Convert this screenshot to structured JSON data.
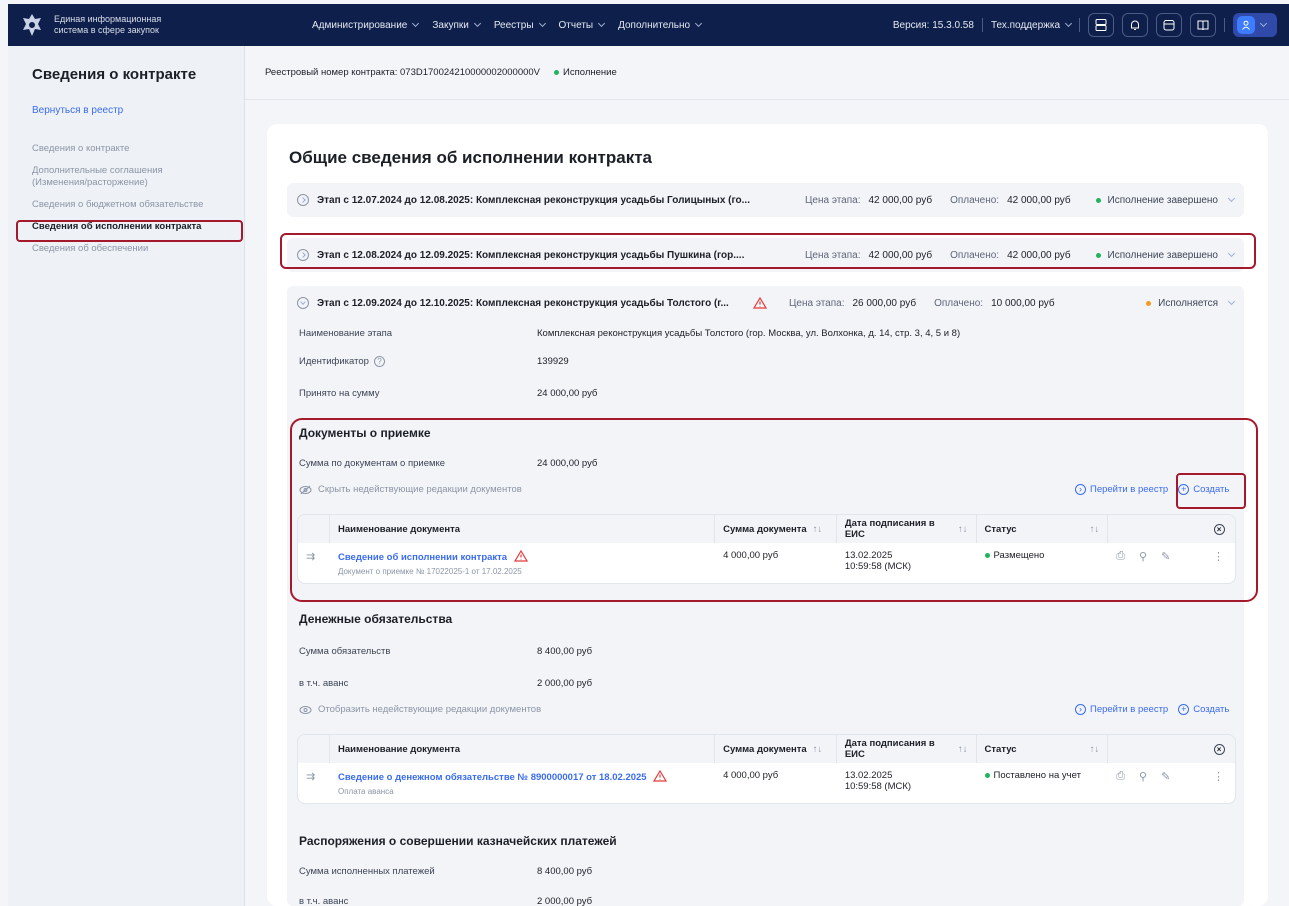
{
  "header": {
    "logo_text_line1": "Единая информационная",
    "logo_text_line2": "система в сфере закупок",
    "nav": [
      "Администрирование",
      "Закупки",
      "Реестры",
      "Отчеты",
      "Дополнительно"
    ],
    "version": "Версия: 15.3.0.58",
    "support": "Тех.поддержка",
    "colors": {
      "header_bg": "#0f1f4b",
      "accent": "#3a6cf0",
      "highlight": "#a5192c"
    }
  },
  "sidebar": {
    "title": "Сведения о контракте",
    "back": "Вернуться в реестр",
    "items": [
      "Сведения о контракте",
      "Дополнительные соглашения",
      "(Изменения/расторжение)",
      "Сведения о бюджетном обязательстве",
      "Сведения об исполнении контракта",
      "Сведения об обеспечении"
    ]
  },
  "topstrip": {
    "reg_number": "Реестровый номер контракта: 073D170024210000002000000V",
    "status": "Исполнение"
  },
  "main": {
    "title": "Общие сведения об исполнении контракта",
    "stages": [
      {
        "name": "Этап с 12.07.2024 до 12.08.2025: Комплексная реконструкция усадьбы Голицыных (го...",
        "price_label": "Цена этапа:",
        "price": "42 000,00 руб",
        "paid_label": "Оплачено:",
        "paid": "42 000,00 руб",
        "status": "Исполнение завершено"
      },
      {
        "name": "Этап с 12.08.2024 до 12.09.2025: Комплексная реконструкция усадьбы Пушкина (гор....",
        "price_label": "Цена этапа:",
        "price": "42 000,00 руб",
        "paid_label": "Оплачено:",
        "paid": "42 000,00 руб",
        "status": "Исполнение завершено"
      },
      {
        "name": "Этап с 12.09.2024 до 12.10.2025: Комплексная реконструкция усадьбы Толстого (г...",
        "price_label": "Цена этапа:",
        "price": "26 000,00 руб",
        "paid_label": "Оплачено:",
        "paid": "10 000,00 руб",
        "status": "Исполняется"
      }
    ],
    "details": {
      "name_label": "Наименование этапа",
      "name_value": "Комплексная реконструкция усадьбы Толстого (гор. Москва, ул. Волхонка, д. 14, стр. 3, 4, 5 и 8)",
      "id_label": "Идентификатор",
      "id_value": "139929",
      "accepted_label": "Принято на сумму",
      "accepted_value": "24 000,00 руб"
    },
    "acceptance": {
      "title": "Документы о приемке",
      "sum_label": "Сумма по документам о приемке",
      "sum_value": "24 000,00 руб",
      "toggle": "Скрыть недействующие редакции документов",
      "goto": "Перейти в реестр",
      "create": "Создать",
      "columns": [
        "Наименование документа",
        "Сумма документа",
        "Дата подписания в ЕИС",
        "Статус"
      ],
      "row": {
        "name": "Сведение об исполнении контракта",
        "sub": "Документ о приемке № 17022025-1 от 17.02.2025",
        "sum": "4 000,00 руб",
        "date": "13.02.2025",
        "time": "10:59:58 (МСК)",
        "status": "Размещено"
      }
    },
    "money": {
      "title": "Денежные обязательства",
      "sum_label": "Сумма обязательств",
      "sum_value": "8 400,00 руб",
      "adv_label": "в т.ч. аванс",
      "adv_value": "2 000,00 руб",
      "toggle": "Отобразить недействующие редакции документов",
      "goto": "Перейти в реестр",
      "create": "Создать",
      "columns": [
        "Наименование документа",
        "Сумма документа",
        "Дата подписания в ЕИС",
        "Статус"
      ],
      "row": {
        "name": "Сведение о денежном обязательстве № 8900000017 от 18.02.2025",
        "sub": "Оплата аванса",
        "sum": "4 000,00 руб",
        "date": "13.02.2025",
        "time": "10:59:58 (МСК)",
        "status": "Поставлено на учет"
      }
    },
    "treasury": {
      "title": "Распоряжения о совершении казначейских платежей",
      "sum_label": "Сумма исполненных платежей",
      "sum_value": "8 400,00 руб",
      "adv_label": "в т.ч. аванс",
      "adv_value": "2 000,00 руб"
    }
  }
}
